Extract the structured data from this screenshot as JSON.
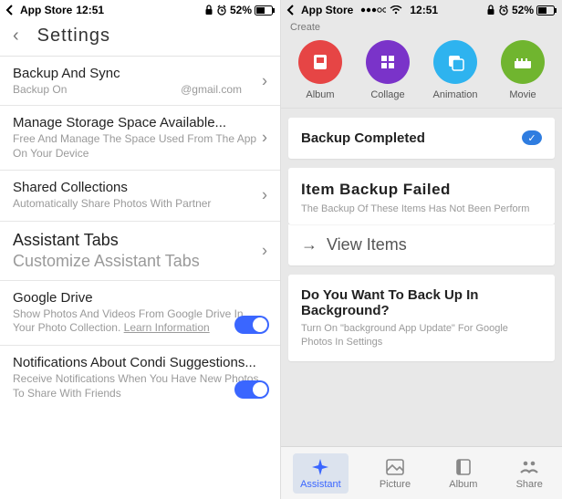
{
  "left": {
    "status": {
      "app": "App Store",
      "time": "12:51",
      "battery": "52%"
    },
    "title": "Settings",
    "rows": {
      "backup": {
        "title": "Backup And Sync",
        "status": "Backup On",
        "account": "@gmail.com"
      },
      "storage": {
        "title": "Manage Storage Space Available...",
        "sub": "Free And Manage The Space Used From The App On Your Device"
      },
      "shared": {
        "title": "Shared Collections",
        "sub": "Automatically Share Photos With Partner"
      },
      "assistant": {
        "title": "Assistant Tabs",
        "sub": "Customize Assistant Tabs"
      },
      "drive": {
        "title": "Google Drive",
        "sub": "Show Photos And Videos From Google Drive In Your Photo Collection. ",
        "link": "Learn Information"
      },
      "notif": {
        "title": "Notifications About Condi Suggestions...",
        "sub": "Receive Notifications When You Have New Photos To Share With Friends"
      }
    }
  },
  "right": {
    "status": {
      "app": "App Store",
      "time": "12:51",
      "battery": "52%"
    },
    "create_label": "Create",
    "actions": {
      "album": "Album",
      "collage": "Collage",
      "animation": "Animation",
      "movie": "Movie"
    },
    "cards": {
      "completed": {
        "title": "Backup Completed"
      },
      "failed": {
        "title": "Item Backup Failed",
        "sub": "The Backup Of These Items Has Not Been Perform",
        "view": "View Items"
      },
      "background": {
        "title": "Do You Want To Back Up In Background?",
        "sub": "Turn On \"background App Update\" For Google Photos In Settings"
      }
    },
    "nav": {
      "assistant": "Assistant",
      "picture": "Picture",
      "album": "Album",
      "share": "Share"
    }
  }
}
